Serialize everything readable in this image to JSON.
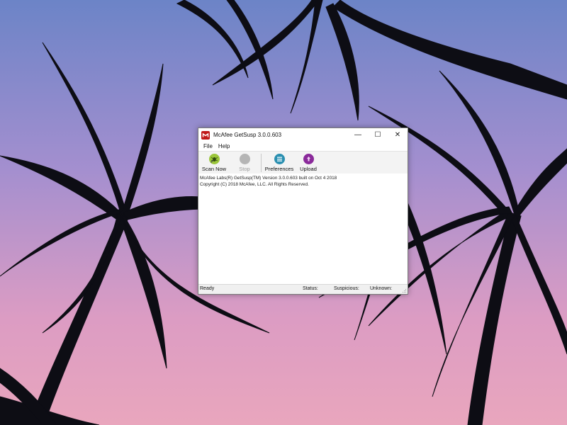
{
  "window": {
    "title": "McAfee GetSusp 3.0.0.603",
    "controls": {
      "minimize": "—",
      "maximize": "☐",
      "close": "✕"
    }
  },
  "menu": {
    "items": [
      "File",
      "Help"
    ]
  },
  "toolbar": {
    "scan_now": "Scan Now",
    "stop": "Stop",
    "preferences": "Preferences",
    "upload": "Upload"
  },
  "log": {
    "lines": [
      "McAfee Labs(R) GetSusp(TM) Version 3.0.0.603 built on Oct  4 2018",
      "Copyright (C) 2018 McAfee, LLC. All Rights Reserved."
    ]
  },
  "status": {
    "ready": "Ready",
    "status_label": "Status:",
    "suspicious_label": "Suspicious:",
    "unknown_label": "Unknown:"
  },
  "icons": {
    "app": "mcafee-shield-icon",
    "scan": "scan-bug-icon",
    "stop": "stop-circle-icon",
    "preferences": "preferences-icon",
    "upload": "upload-icon"
  },
  "colors": {
    "mcafee_red": "#c01818",
    "scan_green": "#9bc63a",
    "prefs_teal": "#2a8fb0",
    "upload_purple": "#8a2a9a"
  }
}
